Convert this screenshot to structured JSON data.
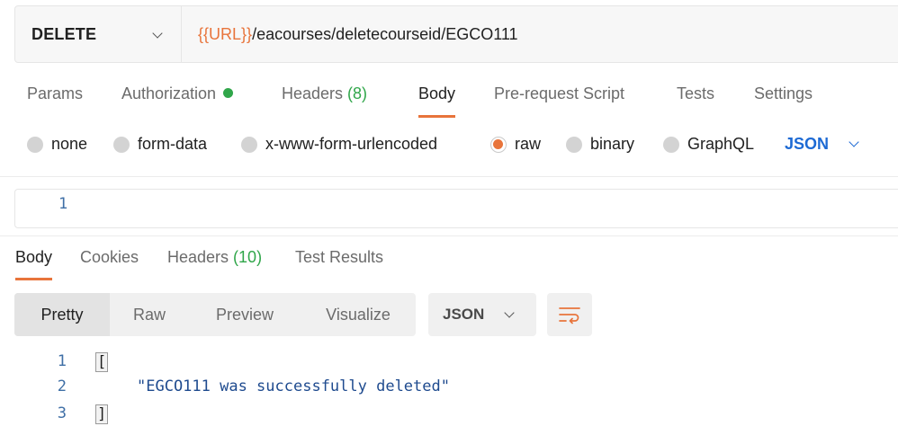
{
  "request": {
    "method": "DELETE",
    "url_variable": "{{URL}}",
    "url_path": "/eacourses/deletecourseid/EGCO111"
  },
  "request_tabs": [
    {
      "label": "Params"
    },
    {
      "label": "Authorization"
    },
    {
      "label": "Headers ",
      "count": "(8)"
    },
    {
      "label": "Body"
    },
    {
      "label": "Pre-request Script"
    },
    {
      "label": "Tests"
    },
    {
      "label": "Settings"
    }
  ],
  "body_types": [
    "none",
    "form-data",
    "x-www-form-urlencoded",
    "raw",
    "binary",
    "GraphQL"
  ],
  "body_format": "JSON",
  "editor": {
    "line": "1"
  },
  "response_tabs": [
    {
      "label": "Body"
    },
    {
      "label": "Cookies"
    },
    {
      "label": "Headers ",
      "count": "(10)"
    },
    {
      "label": "Test Results"
    }
  ],
  "view_modes": [
    "Pretty",
    "Raw",
    "Preview",
    "Visualize"
  ],
  "response_format": "JSON",
  "response_lines": [
    {
      "num": "1",
      "text": "["
    },
    {
      "num": "2",
      "text": "\"EGCO111 was successfully deleted\""
    },
    {
      "num": "3",
      "text": "]"
    }
  ],
  "colors": {
    "accent": "#e8743b",
    "status_green": "#30a64a",
    "link_blue": "#1d6ad4"
  },
  "icons": {
    "auth_status": "green-dot-icon",
    "wrap": "wrap-lines-icon",
    "dropdown": "chevron-down-icon"
  }
}
